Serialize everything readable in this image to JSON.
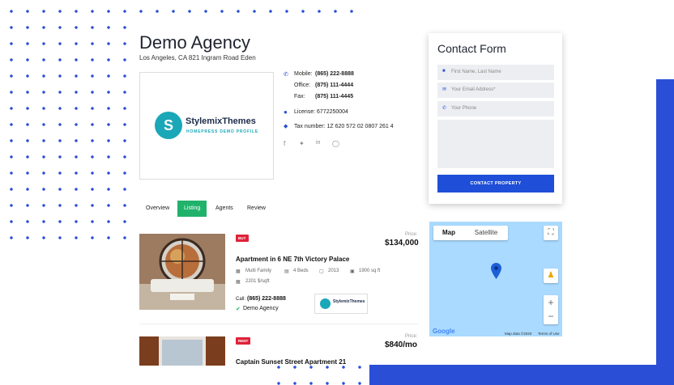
{
  "agency": {
    "name": "Demo Agency",
    "address": "Los Angeles, CA 821 Ingram Road Eden",
    "logo_text": "StylemixThemes",
    "logo_subtitle": "HOMEPRESS DEMO PROFILE",
    "logo_letter": "S"
  },
  "contact_info": {
    "mobile_label": "Mobile:",
    "mobile": "(865) 222-8888",
    "office_label": "Office:",
    "office": "(875) 111-4444",
    "fax_label": "Fax:",
    "fax": "(875) 111-4445",
    "license": "License: 6772250004",
    "tax": "Tax number: 1Z 620 572 02 0807 261 4"
  },
  "social": [
    "facebook-icon",
    "twitter-icon",
    "linkedin-icon",
    "instagram-icon"
  ],
  "tabs": [
    {
      "label": "Overview",
      "active": false
    },
    {
      "label": "Listing",
      "active": true
    },
    {
      "label": "Agents",
      "active": false
    },
    {
      "label": "Review",
      "active": false
    }
  ],
  "listings": [
    {
      "badge": "BUY",
      "price_label": "Price:",
      "price": "$134,000",
      "title": "Apartment in 6 NE 7th Victory Palace",
      "type": "Multi Family",
      "beds": "4 Beds",
      "year": "2013",
      "area": "1900 sq ft",
      "price_per_sqft": "2201 $/sqft",
      "call_label": "Call:",
      "call": "(865) 222-8888",
      "agency": "Demo Agency"
    },
    {
      "badge": "RENT",
      "price_label": "Price:",
      "price": "$840/mo",
      "title": "Captain Sunset Street Apartment 21"
    }
  ],
  "contact_form": {
    "title": "Contact Form",
    "name_placeholder": "First Name, Last Name",
    "email_placeholder": "Your Email Address*",
    "phone_placeholder": "Your Phone",
    "submit": "CONTACT PROPERTY"
  },
  "map": {
    "map_tab": "Map",
    "satellite_tab": "Satellite",
    "zoom_in": "+",
    "zoom_out": "−",
    "google": "Google",
    "map_data": "Map data ©2020",
    "terms": "Terms of Use"
  },
  "colors": {
    "accent": "#2a4fd6",
    "tab_active": "#20b26b",
    "badge": "#e0223a",
    "cta": "#1f4fd8"
  }
}
